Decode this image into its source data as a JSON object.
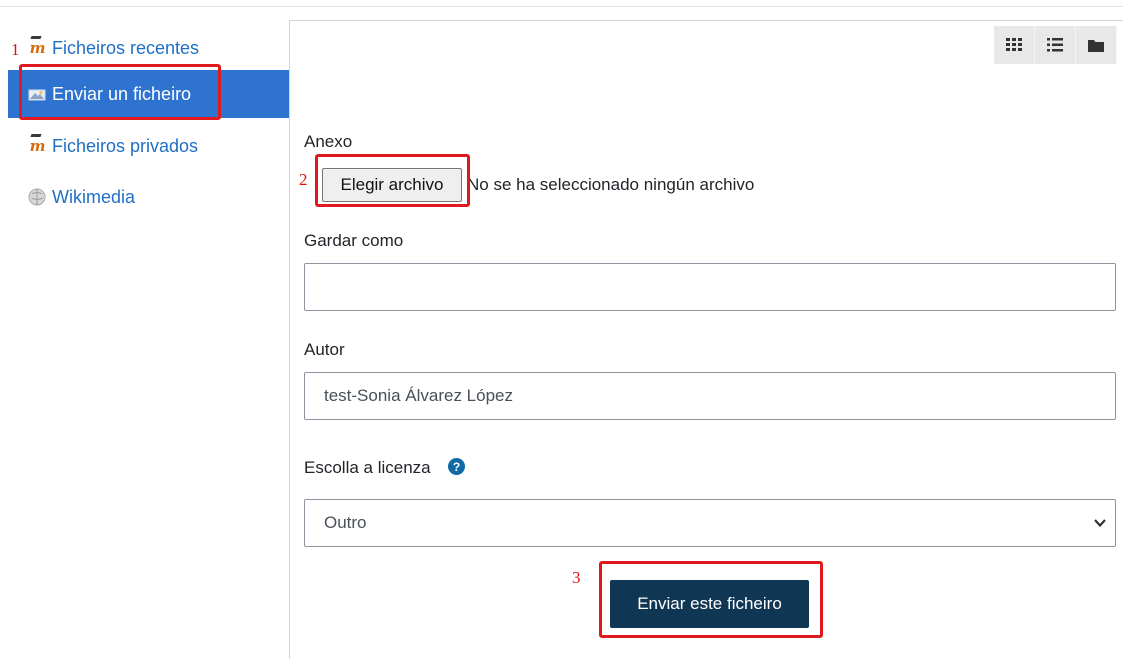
{
  "sidebar": {
    "items": [
      {
        "label": "Ficheiros recentes",
        "icon": "moodle-icon",
        "active": false
      },
      {
        "label": "Enviar un ficheiro",
        "icon": "upload-icon",
        "active": true
      },
      {
        "label": "Ficheiros privados",
        "icon": "moodle-icon",
        "active": false
      },
      {
        "label": "Wikimedia",
        "icon": "wikimedia-icon",
        "active": false
      }
    ]
  },
  "view_toggles": [
    {
      "icon": "grid-view-icon"
    },
    {
      "icon": "list-view-icon"
    },
    {
      "icon": "folder-view-icon"
    }
  ],
  "form": {
    "attachment_label": "Anexo",
    "choose_file_label": "Elegir archivo",
    "no_file_text": "No se ha seleccionado ningún archivo",
    "save_as_label": "Gardar como",
    "save_as_value": "",
    "author_label": "Autor",
    "author_value": "test-Sonia Álvarez López",
    "license_label": "Escolla a licenza",
    "license_help_glyph": "?",
    "license_value": "Outro",
    "submit_label": "Enviar este ficheiro"
  },
  "annotations": [
    {
      "number": "1"
    },
    {
      "number": "2"
    },
    {
      "number": "3"
    }
  ],
  "colors": {
    "accent": "#2f73d0",
    "link": "#1f6fc5",
    "submit": "#0f3754",
    "annotation": "#e0191e"
  }
}
